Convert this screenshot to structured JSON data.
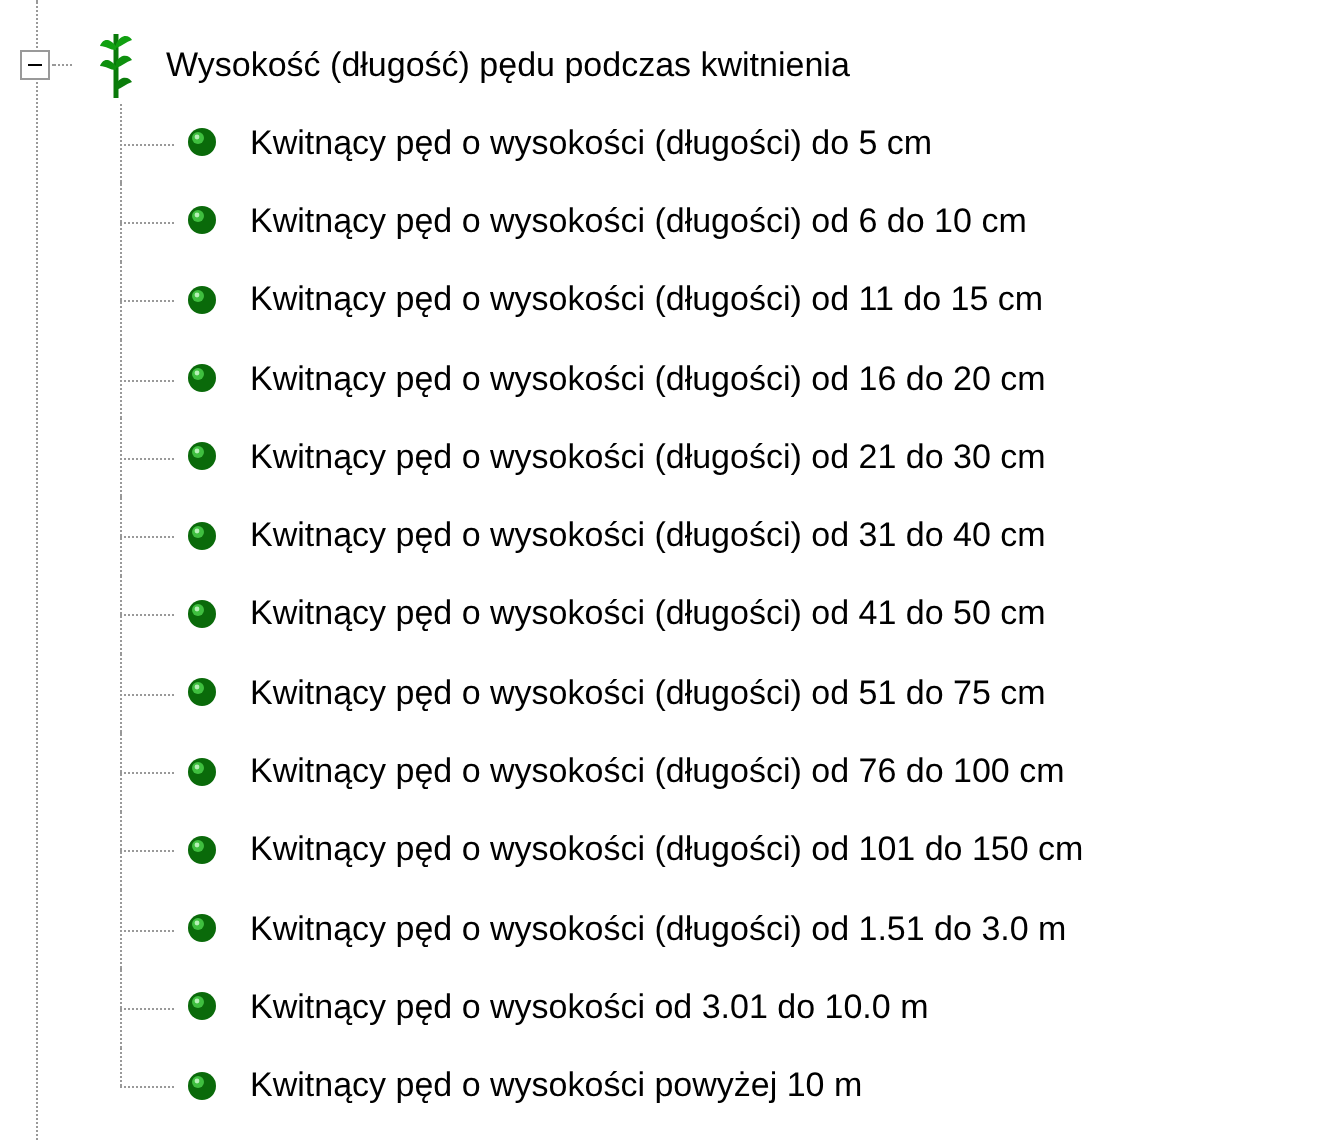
{
  "tree": {
    "label": "Wysokość (długość) pędu podczas kwitnienia",
    "expanded": true,
    "children": [
      {
        "label": "Kwitnący pęd o wysokości (długości) do 5 cm"
      },
      {
        "label": "Kwitnący pęd o wysokości (długości) od 6 do 10 cm"
      },
      {
        "label": "Kwitnący pęd o wysokości (długości) od 11 do 15 cm"
      },
      {
        "label": "Kwitnący pęd o wysokości (długości) od 16 do 20 cm"
      },
      {
        "label": "Kwitnący pęd o wysokości (długości) od 21 do 30 cm"
      },
      {
        "label": "Kwitnący pęd o wysokości (długości) od 31 do 40 cm"
      },
      {
        "label": "Kwitnący pęd o wysokości (długości) od 41 do 50 cm"
      },
      {
        "label": "Kwitnący pęd o wysokości (długości) od 51 do 75 cm"
      },
      {
        "label": "Kwitnący pęd o wysokości (długości) od 76 do 100 cm"
      },
      {
        "label": "Kwitnący pęd o wysokości (długości) od 101 do 150 cm"
      },
      {
        "label": "Kwitnący pęd o wysokości (długości) od 1.51 do 3.0 m"
      },
      {
        "label": "Kwitnący pęd o wysokości od 3.01 do 10.0 m"
      },
      {
        "label": "Kwitnący pęd o wysokości powyżej 10 m"
      }
    ]
  }
}
